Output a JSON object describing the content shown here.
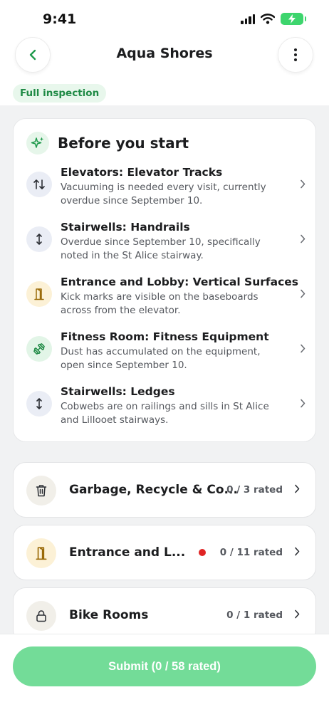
{
  "status_bar": {
    "time": "9:41"
  },
  "header": {
    "title": "Aqua Shores"
  },
  "badge": {
    "label": "Full inspection"
  },
  "before_start": {
    "title": "Before you start",
    "tasks": [
      {
        "title": "Elevators: Elevator Tracks",
        "description": "Vacuuming is needed every visit, currently overdue since September 10.",
        "icon": "arrows-up-down-icon"
      },
      {
        "title": "Stairwells: Handrails",
        "description": "Overdue since September 10, specifically noted in the St Alice stairway.",
        "icon": "arrow-vertical-icon"
      },
      {
        "title": "Entrance and Lobby: Vertical Surfaces",
        "description": "Kick marks are visible on the baseboards across from the elevator.",
        "icon": "door-icon"
      },
      {
        "title": "Fitness Room: Fitness Equipment",
        "description": "Dust has accumulated on the equipment, open since September 10.",
        "icon": "dumbbell-icon"
      },
      {
        "title": "Stairwells: Ledges",
        "description": "Cobwebs are on railings and sills in St Alice and Lillooet stairways.",
        "icon": "arrow-vertical-icon"
      }
    ]
  },
  "sections": [
    {
      "name": "Garbage, Recycle & Co...",
      "count": "0 / 3 rated",
      "icon": "trash-icon"
    },
    {
      "name": "Entrance and L...",
      "count": "0 / 11 rated",
      "icon": "door-icon",
      "alert": true
    },
    {
      "name": "Bike Rooms",
      "count": "0 / 1 rated",
      "icon": "lock-icon"
    }
  ],
  "footer": {
    "submit_label": "Submit (0 / 58 rated)"
  },
  "colors": {
    "accent_green": "#1f8a45",
    "submit_green": "#73dc98",
    "alert_red": "#e02424"
  }
}
